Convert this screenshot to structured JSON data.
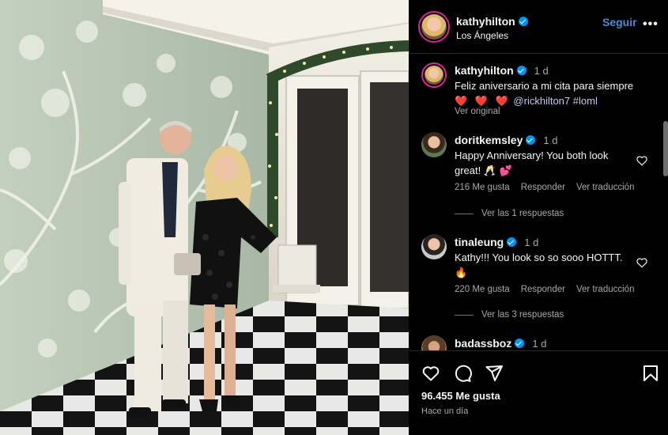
{
  "post": {
    "username": "kathyhilton",
    "location": "Los Ángeles",
    "follow_label": "Seguir",
    "more_label": "•••"
  },
  "caption": {
    "username": "kathyhilton",
    "time": "1 d",
    "text": "Feliz aniversario a mi cita para siempre",
    "hearts": "❤️ ❤️ ❤️",
    "mention": "@rickhilton7",
    "hashtag": "#loml",
    "see_original": "Ver original"
  },
  "comments": [
    {
      "username": "doritkemsley",
      "time": "1 d",
      "text": "Happy Anniversary! You both look great! 🥂 💕",
      "likes": "216 Me gusta",
      "reply": "Responder",
      "translate": "Ver traducción",
      "replies": "Ver las 1 respuestas"
    },
    {
      "username": "tinaleung",
      "time": "1 d",
      "text": "Kathy!!! You look so so sooo HOTTT. 🔥",
      "likes": "220 Me gusta",
      "reply": "Responder",
      "translate": "Ver traducción",
      "replies": "Ver las 3 respuestas"
    },
    {
      "username": "badassboz",
      "time": "1 d"
    }
  ],
  "footer": {
    "likes_count": "96.455 Me gusta",
    "time_ago": "Hace un día"
  },
  "icons": {
    "verified": "verified-badge-icon",
    "like": "heart-icon",
    "comment": "comment-icon",
    "share": "paper-plane-icon",
    "save": "bookmark-icon"
  },
  "colors": {
    "background": "#000000",
    "link": "#c0cbf5",
    "follow": "#4c8dd6",
    "verified": "#0095f6"
  }
}
